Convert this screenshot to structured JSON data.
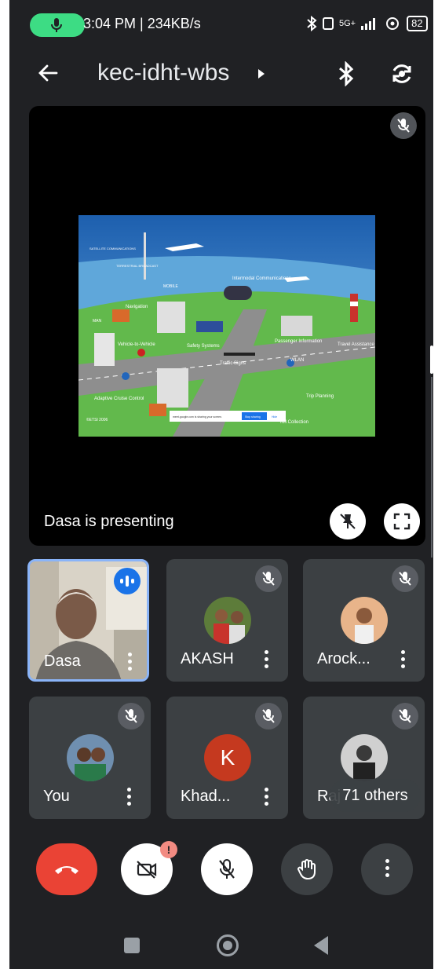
{
  "status_bar": {
    "time_speed": "3:04 PM | 234KB/s",
    "network": "5G+",
    "battery": "82"
  },
  "header": {
    "room_code": "kec-idht-wbs",
    "back_icon": "arrow-back-icon",
    "bluetooth_icon": "bluetooth-icon",
    "switch_camera_icon": "switch-camera-icon"
  },
  "presentation": {
    "label": "Dasa is presenting",
    "slide_labels": {
      "satellite": "SATELLITE COMMUNICATIONS",
      "terrestrial": "TERRESTRIAL BROADCAST",
      "mobile": "MOBILE",
      "intermodal": "Intermodal Communications",
      "navigation": "Navigation",
      "man": "MAN",
      "v2v": "Vehicle-to-Vehicle",
      "safety": "Safety Systems",
      "signs": "Traffic Signs",
      "passenger": "Passenger Information",
      "travel": "Travel Assistance",
      "wlan": "WLAN",
      "acc": "Adaptive Cruise Control",
      "trip": "Trip Planning",
      "toll": "Toll Collection",
      "etsi": "©ETSI 2006",
      "share_text": "meet.google.com is sharing your screen.",
      "stop_sharing": "Stop sharing",
      "hide": "Hide"
    }
  },
  "participants": [
    {
      "name": "Dasa",
      "state": "speaking"
    },
    {
      "name": "AKASH",
      "state": "muted"
    },
    {
      "name": "Arock...",
      "state": "muted"
    },
    {
      "name": "You",
      "state": "muted"
    },
    {
      "name": "Khad...",
      "state": "muted",
      "initial": "K"
    },
    {
      "name": "Raj",
      "state": "muted"
    }
  ],
  "others_label": "71 others",
  "controls": {
    "camera_alert": "!",
    "end_call_color": "#ea4335"
  },
  "colors": {
    "background": "#202124",
    "tile": "#3c4043",
    "status_mic": "#3ddc84",
    "speaking": "#1a73e8"
  }
}
